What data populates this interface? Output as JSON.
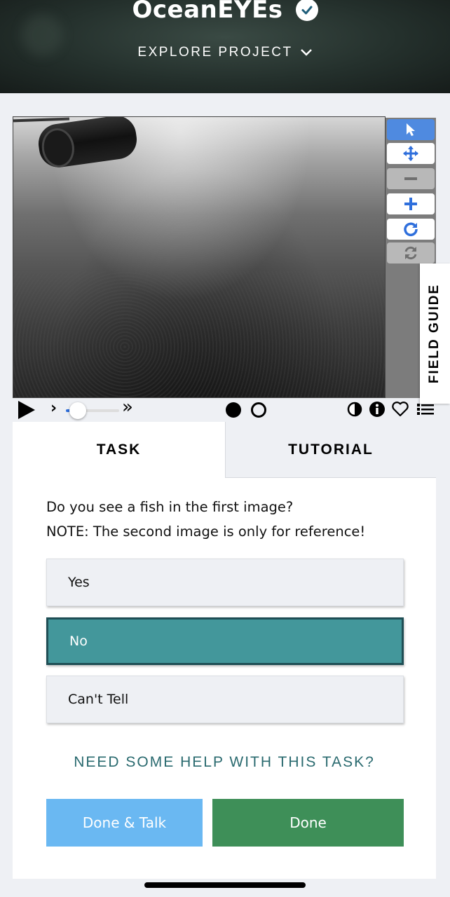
{
  "header": {
    "project_title": "OceanEYEs",
    "explore_label": "EXPLORE PROJECT"
  },
  "viewer": {
    "tools": [
      {
        "name": "pointer-icon",
        "state": "active"
      },
      {
        "name": "move-icon",
        "state": "normal"
      },
      {
        "name": "zoom-out-icon",
        "state": "disabled"
      },
      {
        "name": "zoom-in-icon",
        "state": "normal"
      },
      {
        "name": "rotate-icon",
        "state": "normal"
      },
      {
        "name": "reset-icon",
        "state": "disabled"
      }
    ],
    "field_guide_label": "FIELD GUIDE"
  },
  "controls": {
    "playback_speed_fraction": 0.2,
    "current_frame": 1,
    "frame_count": 2
  },
  "tabs": {
    "task": "TASK",
    "tutorial": "TUTORIAL"
  },
  "task": {
    "question_line1": "Do you see a fish in the first image?",
    "question_line2": "NOTE: The second image is only for reference!",
    "answers": [
      {
        "label": "Yes",
        "selected": false
      },
      {
        "label": "No",
        "selected": true
      },
      {
        "label": "Can't Tell",
        "selected": false
      }
    ],
    "help_link": "NEED SOME HELP WITH THIS TASK?",
    "done_talk_label": "Done & Talk",
    "done_label": "Done"
  },
  "colors": {
    "accent_blue": "#2f6fdc",
    "selected_answer": "#43979b",
    "done_button": "#3e8f58",
    "done_talk_button": "#6ab8f2",
    "help_link": "#2a6a6f"
  }
}
